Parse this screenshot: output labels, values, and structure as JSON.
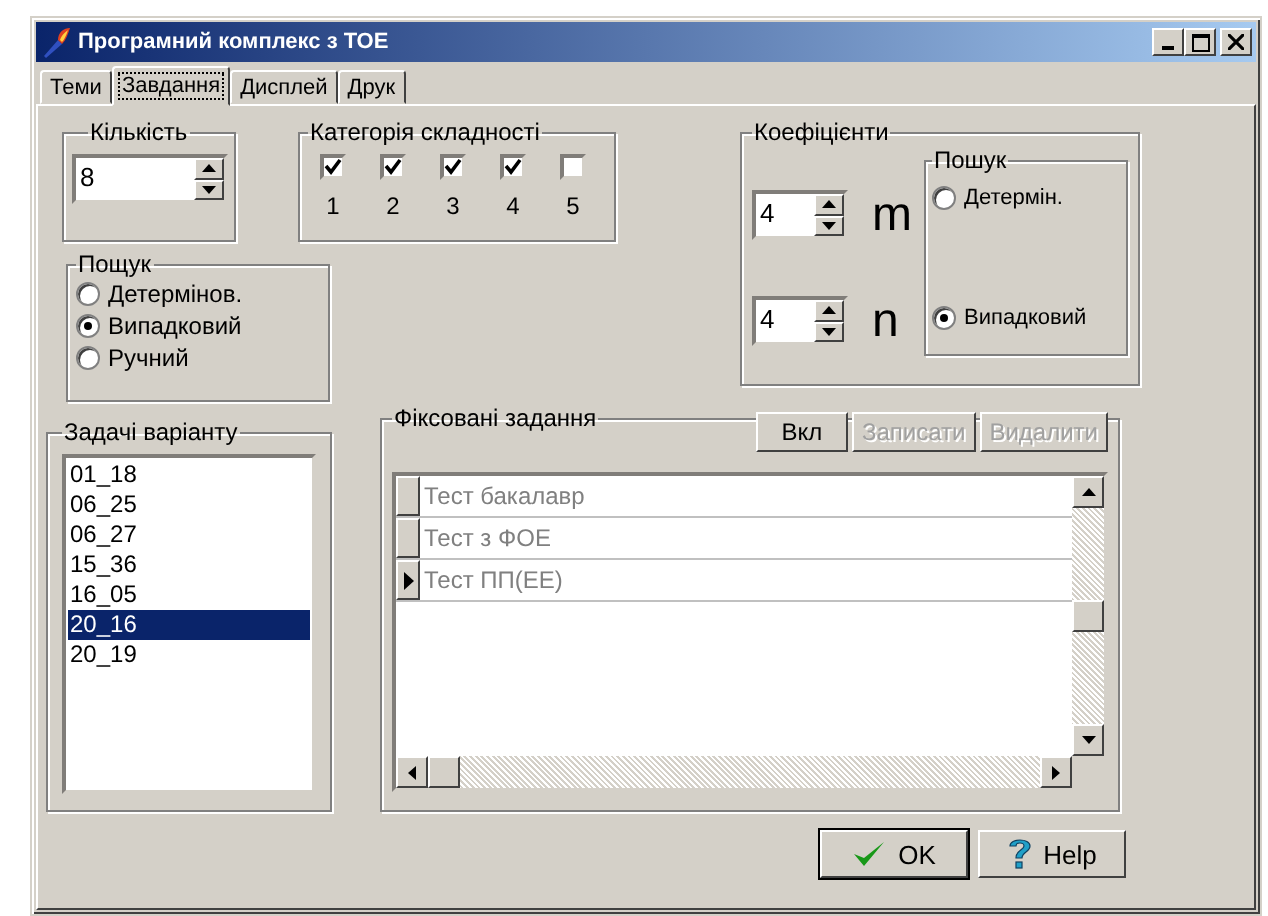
{
  "window": {
    "title": "Програмний комплекс з ТОЕ"
  },
  "tabs": [
    {
      "label": "Теми",
      "selected": false
    },
    {
      "label": "Завдання",
      "selected": true
    },
    {
      "label": "Дисплей",
      "selected": false
    },
    {
      "label": "Друк",
      "selected": false
    }
  ],
  "count": {
    "label": "Кількість",
    "value": "8"
  },
  "difficulty": {
    "label": "Категорія складності",
    "items": [
      {
        "label": "1",
        "checked": true
      },
      {
        "label": "2",
        "checked": true
      },
      {
        "label": "3",
        "checked": true
      },
      {
        "label": "4",
        "checked": true
      },
      {
        "label": "5",
        "checked": false
      }
    ]
  },
  "search": {
    "label": "Пощук",
    "options": [
      {
        "label": "Детермінов.",
        "selected": false
      },
      {
        "label": "Випадковий",
        "selected": true
      },
      {
        "label": "Ручний",
        "selected": false
      }
    ]
  },
  "coefficients": {
    "label": "Коефіцієнти",
    "spins": [
      {
        "value": "4",
        "symbol": "m"
      },
      {
        "value": "4",
        "symbol": "n"
      }
    ],
    "search": {
      "label": "Пошук",
      "options": [
        {
          "label": "Детермін.",
          "selected": false
        },
        {
          "label": "Випадковий",
          "selected": true
        }
      ]
    }
  },
  "variant_tasks": {
    "label": "Задачі варіанту",
    "items": [
      {
        "label": "01_18",
        "selected": false
      },
      {
        "label": "06_25",
        "selected": false
      },
      {
        "label": "06_27",
        "selected": false
      },
      {
        "label": "15_36",
        "selected": false
      },
      {
        "label": "16_05",
        "selected": false
      },
      {
        "label": "20_16",
        "selected": true
      },
      {
        "label": "20_19",
        "selected": false
      }
    ]
  },
  "fixed_tasks": {
    "label": "Фіксовані задання",
    "buttons": [
      {
        "label": "Вкл",
        "disabled": false
      },
      {
        "label": "Записати",
        "disabled": true
      },
      {
        "label": "Видалити",
        "disabled": true
      }
    ],
    "rows": [
      {
        "text": "Тест бакалавр",
        "current": false
      },
      {
        "text": "Тест з ФОЕ",
        "current": false
      },
      {
        "text": "Тест ПП(ЕЕ)",
        "current": true
      }
    ]
  },
  "buttons": [
    {
      "label": "OK",
      "kind": "ok"
    },
    {
      "label": "Help",
      "kind": "help"
    }
  ]
}
